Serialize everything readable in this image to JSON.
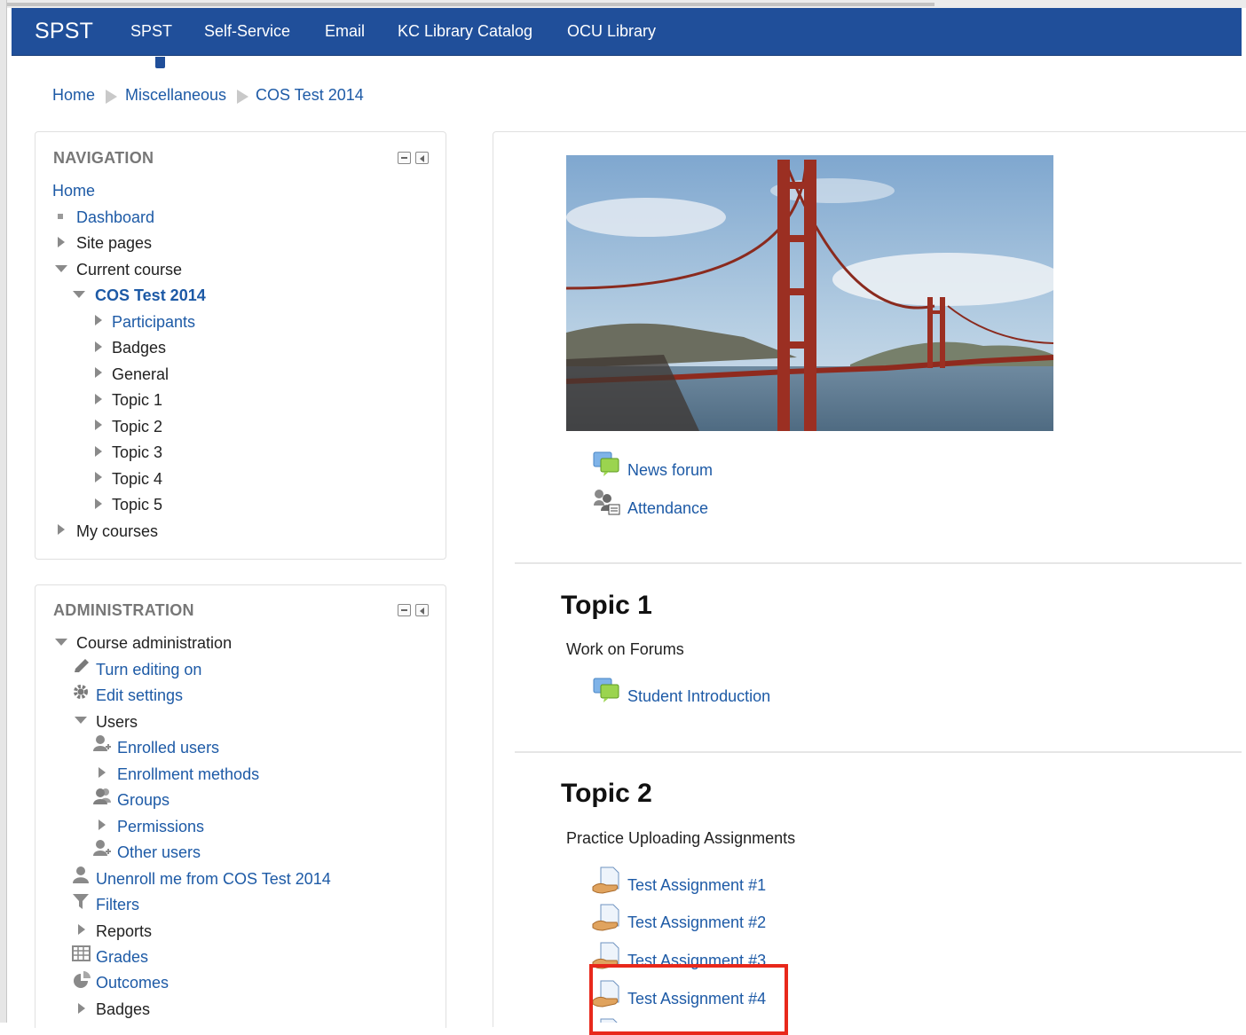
{
  "navbar": {
    "brand": "SPST",
    "links": [
      "SPST",
      "Self-Service",
      "Email",
      "KC Library Catalog",
      "OCU Library"
    ]
  },
  "breadcrumb": [
    "Home",
    "Miscellaneous",
    "COS Test 2014"
  ],
  "navigation": {
    "title": "NAVIGATION",
    "home": "Home",
    "dashboard": "Dashboard",
    "site_pages": "Site pages",
    "current_course": "Current course",
    "course": "COS Test 2014",
    "course_items": [
      "Participants",
      "Badges",
      "General",
      "Topic 1",
      "Topic 2",
      "Topic 3",
      "Topic 4",
      "Topic 5"
    ],
    "my_courses": "My courses"
  },
  "administration": {
    "title": "ADMINISTRATION",
    "course_admin": "Course administration",
    "turn_editing_on": "Turn editing on",
    "edit_settings": "Edit settings",
    "users": "Users",
    "enrolled_users": "Enrolled users",
    "enrollment_methods": "Enrollment methods",
    "groups": "Groups",
    "permissions": "Permissions",
    "other_users": "Other users",
    "unenroll": "Unenroll me from COS Test 2014",
    "filters": "Filters",
    "reports": "Reports",
    "grades": "Grades",
    "outcomes": "Outcomes",
    "badges": "Badges"
  },
  "course_main": {
    "general_activities": [
      "News forum",
      "Attendance"
    ],
    "topic1": {
      "title": "Topic 1",
      "summary": "Work on Forums",
      "activities": [
        "Student Introduction"
      ]
    },
    "topic2": {
      "title": "Topic 2",
      "summary": "Practice Uploading Assignments",
      "activities": [
        "Test Assignment #1",
        "Test Assignment #2",
        "Test Assignment #3",
        "Test Assignment #4"
      ]
    }
  },
  "colors": {
    "navbar": "#204f9a",
    "link": "#1d5aa6",
    "highlight": "#e8281b"
  }
}
